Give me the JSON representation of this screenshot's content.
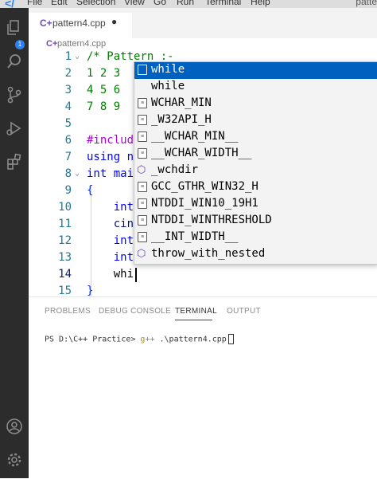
{
  "menubar": {
    "items": [
      "File",
      "Edit",
      "Selection",
      "View",
      "Go",
      "Run",
      "Terminal",
      "Help"
    ],
    "window_title": "patte"
  },
  "activity": {
    "source_control_badge": "1"
  },
  "tab": {
    "icon": "C+",
    "label": "pattern4.cpp"
  },
  "breadcrumb": {
    "icon": "C+",
    "label": "pattern4.cpp"
  },
  "editor": {
    "line_numbers": [
      "1",
      "2",
      "3",
      "4",
      "5",
      "6",
      "7",
      "8",
      "9",
      "10",
      "11",
      "12",
      "13",
      "14",
      "15"
    ],
    "lines": [
      {
        "n": "1",
        "text": "/* Pattern :-"
      },
      {
        "n": "2",
        "text": "1 2 3"
      },
      {
        "n": "3",
        "text": "4 5 6"
      },
      {
        "n": "4",
        "text": "7 8 9"
      },
      {
        "n": "6",
        "text": "#includ"
      },
      {
        "n": "7",
        "text": "using n"
      },
      {
        "n": "8",
        "text": "int mai"
      },
      {
        "n": "9",
        "text": "{"
      },
      {
        "n": "10",
        "text": "    int"
      },
      {
        "n": "11",
        "text": "    cin"
      },
      {
        "n": "12",
        "text": "    int"
      },
      {
        "n": "13",
        "text": "    int"
      },
      {
        "n": "14",
        "text": "    whi"
      },
      {
        "n": "15",
        "text": "}"
      }
    ]
  },
  "suggestions": [
    {
      "label": "while",
      "icon": "snippet",
      "selected": true
    },
    {
      "label": "while",
      "icon": "keyword"
    },
    {
      "label": "WCHAR_MIN",
      "icon": "text"
    },
    {
      "label": "_W32API_H",
      "icon": "text"
    },
    {
      "label": "__WCHAR_MIN__",
      "icon": "text"
    },
    {
      "label": "__WCHAR_WIDTH__",
      "icon": "text"
    },
    {
      "label": "_wchdir",
      "icon": "method"
    },
    {
      "label": "GCC_GTHR_WIN32_H",
      "icon": "text"
    },
    {
      "label": "NTDDI_WIN10_19H1",
      "icon": "text"
    },
    {
      "label": "NTDDI_WINTHRESHOLD",
      "icon": "text"
    },
    {
      "label": "__INT_WIDTH__",
      "icon": "text"
    },
    {
      "label": "throw_with_nested",
      "icon": "method"
    }
  ],
  "panel": {
    "tabs": [
      "PROBLEMS",
      "DEBUG CONSOLE",
      "TERMINAL",
      "OUTPUT"
    ],
    "active_tab": "TERMINAL",
    "terminal": {
      "prompt": "PS D:\\C++ Practice> ",
      "command": "g++",
      "args": " .\\pattern4.cpp"
    }
  },
  "colors": {
    "line_number": "#237893",
    "comment_green": "#008000",
    "keyword_blue": "#0000ff",
    "macro_purple": "#af00db",
    "variable": "#001080",
    "selection": "#0060c0"
  }
}
